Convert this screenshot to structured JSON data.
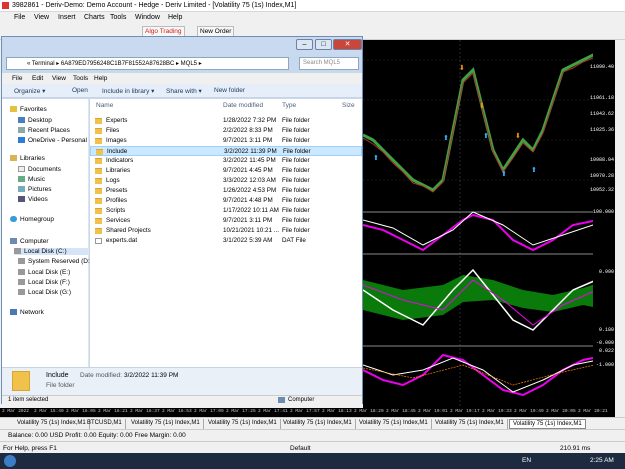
{
  "app": {
    "title": "3982861 - Deriv-Demo: Demo Account - Hedge - Deriv Limited - [Volatility 75 (1s) Index,M1]",
    "menu": [
      "File",
      "View",
      "Insert",
      "Charts",
      "Tools",
      "Window",
      "Help"
    ],
    "toolbar": {
      "algo": "Algo Trading",
      "new_order": "New Order"
    }
  },
  "explorer": {
    "address": "« Terminal ▸ 6A879ED7956248C1B7F81552A87628BC ▸ MQL5 ▸",
    "search_placeholder": "Search MQL5",
    "menu": [
      "File",
      "Edit",
      "View",
      "Tools",
      "Help"
    ],
    "commands": [
      "Organize ▾",
      "Open",
      "Include in library ▾",
      "Share with ▾",
      "New folder"
    ],
    "nav": {
      "favorites": "Favorites",
      "fav_items": [
        "Desktop",
        "Recent Places",
        "OneDrive - Personal"
      ],
      "libraries": "Libraries",
      "lib_items": [
        "Documents",
        "Music",
        "Pictures",
        "Videos"
      ],
      "homegroup": "Homegroup",
      "computer": "Computer",
      "drives": [
        "Local Disk (C:)",
        "System Reserved (D:)",
        "Local Disk (E:)",
        "Local Disk (F:)",
        "Local Disk (G:)"
      ],
      "network": "Network"
    },
    "columns": {
      "name": "Name",
      "date": "Date modified",
      "type": "Type",
      "size": "Size"
    },
    "files": [
      {
        "name": "Experts",
        "date": "1/28/2022 7:32 PM",
        "type": "File folder"
      },
      {
        "name": "Files",
        "date": "2/2/2022 8:33 PM",
        "type": "File folder"
      },
      {
        "name": "Images",
        "date": "9/7/2021 3:11 PM",
        "type": "File folder"
      },
      {
        "name": "Include",
        "date": "3/2/2022 11:39 PM",
        "type": "File folder"
      },
      {
        "name": "Indicators",
        "date": "3/2/2022 11:45 PM",
        "type": "File folder"
      },
      {
        "name": "Libraries",
        "date": "9/7/2021 4:45 PM",
        "type": "File folder"
      },
      {
        "name": "Logs",
        "date": "3/3/2022 12:03 AM",
        "type": "File folder"
      },
      {
        "name": "Presets",
        "date": "1/26/2022 4:53 PM",
        "type": "File folder"
      },
      {
        "name": "Profiles",
        "date": "9/7/2021 4:48 PM",
        "type": "File folder"
      },
      {
        "name": "Scripts",
        "date": "1/17/2022 10:11 AM",
        "type": "File folder"
      },
      {
        "name": "Services",
        "date": "9/7/2021 3:11 PM",
        "type": "File folder"
      },
      {
        "name": "Shared Projects",
        "date": "10/21/2021 10:21 ...",
        "type": "File folder"
      },
      {
        "name": "experts.dat",
        "date": "3/1/2022 5:39 AM",
        "type": "DAT File"
      }
    ],
    "details": {
      "name": "Include",
      "date_label": "Date modified:",
      "date": "3/2/2022 11:39 PM",
      "kind": "File folder"
    },
    "status": {
      "left": "1 item selected",
      "right": "Computer"
    }
  },
  "chart": {
    "y_labels": [
      "11090.40",
      "11061.18",
      "11043.62",
      "11025.36",
      "10988.04",
      "10970.28",
      "10952.32",
      "100.000",
      "0.990",
      "0.180",
      "-0.000",
      "-1.000",
      "0.022"
    ],
    "x_labels": [
      "2 Mar 2022",
      "2 Mar 15:40",
      "2 Mar 16:05",
      "2 Mar 16:21",
      "2 Mar 16:37",
      "2 Mar 16:53",
      "2 Mar 17:09",
      "2 Mar 17:25",
      "2 Mar 17:41",
      "2 Mar 17:57",
      "2 Mar 18:13",
      "2 Mar 18:29",
      "2 Mar 18:45",
      "2 Mar 19:01",
      "2 Mar 19:17",
      "2 Mar 19:33",
      "2 Mar 19:49",
      "2 Mar 20:05",
      "2 Mar 20:21"
    ],
    "tabs": [
      "Volatility 75 (1s) Index,M1",
      "BTCUSD,M1",
      "Volatility 75 (1s) Index,M1",
      "Volatility 75 (1s) Index,M1",
      "Volatility 75 (1s) Index,M1",
      "Volatility 75 (1s) Index,M1",
      "Volatility 75 (1s) Index,M1",
      "Volatility 75 (1s) Index,M1"
    ],
    "account": "Balance: 0.00 USD  Profit: 0.00  Equity: 0.00  Free Margin: 0.00"
  },
  "status": {
    "help": "For Help, press F1",
    "profile": "Default",
    "ping": "210.91 ms"
  },
  "taskbar": {
    "lang": "EN",
    "time": "2:25 AM"
  }
}
